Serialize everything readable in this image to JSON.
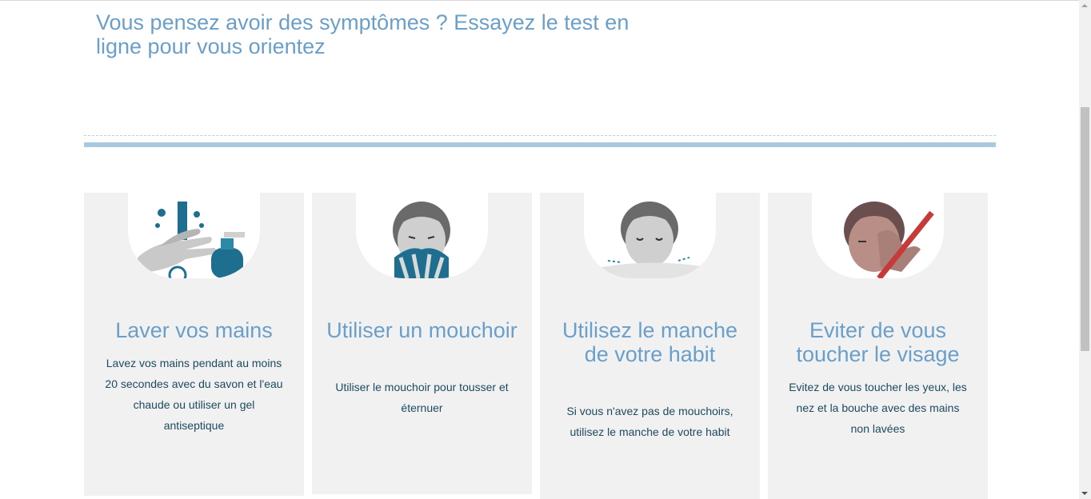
{
  "headline": "Vous pensez avoir des symptômes ? Essayez le test en ligne pour vous orientez",
  "colors": {
    "accent": "#6a9fc9",
    "body_text": "#1d4a5e",
    "card_bg": "#f1f1f1",
    "divider": "#a9c9e1"
  },
  "cards": [
    {
      "icon": "hand-washing-icon",
      "title": "Laver vos mains",
      "text": "Lavez vos mains pendant au moins 20 secondes avec du savon et l'eau chaude ou utiliser un gel antiseptique"
    },
    {
      "icon": "tissue-sneeze-icon",
      "title": "Utiliser un mouchoir",
      "text": "Utiliser le mouchoir pour tousser et éternuer"
    },
    {
      "icon": "sleeve-cough-icon",
      "title": "Utilisez le manche de votre habit",
      "text": "Si vous n'avez pas de mouchoirs, utilisez le manche de votre habit"
    },
    {
      "icon": "no-face-touch-icon",
      "title": "Eviter de vous toucher le visage",
      "text": "Evitez de vous toucher les yeux, les nez et la bouche avec des mains non lavées"
    }
  ]
}
